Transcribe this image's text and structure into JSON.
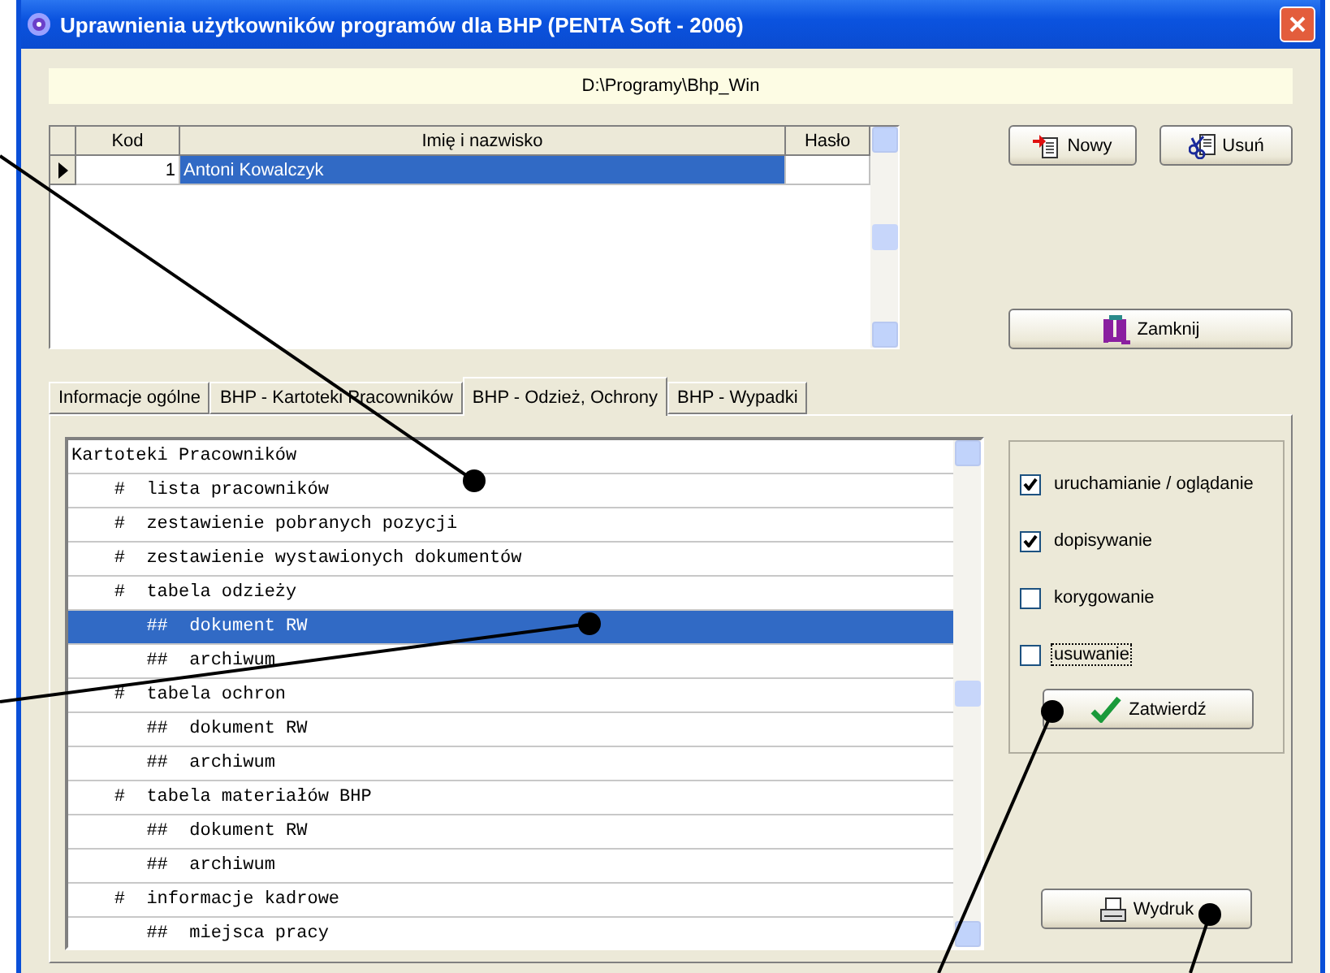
{
  "window": {
    "title": "Uprawnienia użytkowników programów dla BHP (PENTA Soft - 2006)"
  },
  "path": "D:\\Programy\\Bhp_Win",
  "grid": {
    "columns": [
      "Kod",
      "Imię i nazwisko",
      "Hasło"
    ],
    "rows": [
      {
        "kod": "1",
        "name": "Antoni Kowalczyk",
        "selected": true
      }
    ]
  },
  "top_buttons": [
    {
      "label": "Nowy",
      "kind": "new"
    },
    {
      "label": "Usuń",
      "kind": "delete"
    }
  ],
  "close_button": {
    "label": "Zamknij"
  },
  "tabs": [
    {
      "label": "Informacje ogólne",
      "selected": false
    },
    {
      "label": "BHP - Kartoteki Pracowników",
      "selected": false
    },
    {
      "label": "BHP - Odzież, Ochrony",
      "selected": true
    },
    {
      "label": "BHP - Wypadki",
      "selected": false
    }
  ],
  "tree": [
    {
      "label": "Kartoteki Pracowników",
      "selected": false,
      "children": [
        {
          "marker": "#",
          "label": "lista pracowników",
          "selected": false
        },
        {
          "marker": "#",
          "label": "zestawienie pobranych pozycji",
          "selected": false
        },
        {
          "marker": "#",
          "label": "zestawienie wystawionych dokumentów",
          "selected": false
        },
        {
          "marker": "#",
          "label": "tabela odzieży",
          "selected": false,
          "children": [
            {
              "marker": "##",
              "label": "dokument RW",
              "selected": true
            },
            {
              "marker": "##",
              "label": "archiwum",
              "selected": false
            }
          ]
        },
        {
          "marker": "#",
          "label": "tabela ochron",
          "selected": false,
          "children": [
            {
              "marker": "##",
              "label": "dokument RW",
              "selected": false
            },
            {
              "marker": "##",
              "label": "archiwum",
              "selected": false
            }
          ]
        },
        {
          "marker": "#",
          "label": "tabela materiałów BHP",
          "selected": false,
          "children": [
            {
              "marker": "##",
              "label": "dokument RW",
              "selected": false
            },
            {
              "marker": "##",
              "label": "archiwum",
              "selected": false
            }
          ]
        },
        {
          "marker": "#",
          "label": "informacje kadrowe",
          "selected": false,
          "children": [
            {
              "marker": "##",
              "label": "miejsca pracy",
              "selected": false
            }
          ]
        }
      ]
    }
  ],
  "permissions": [
    {
      "label": "uruchamianie / oglądanie",
      "checked": true,
      "focused": false
    },
    {
      "label": "dopisywanie",
      "checked": true,
      "focused": false
    },
    {
      "label": "korygowanie",
      "checked": false,
      "focused": false
    },
    {
      "label": "usuwanie",
      "checked": false,
      "focused": true
    }
  ],
  "confirm_button": {
    "label": "Zatwierdź"
  },
  "print_button": {
    "label": "Wydruk"
  }
}
